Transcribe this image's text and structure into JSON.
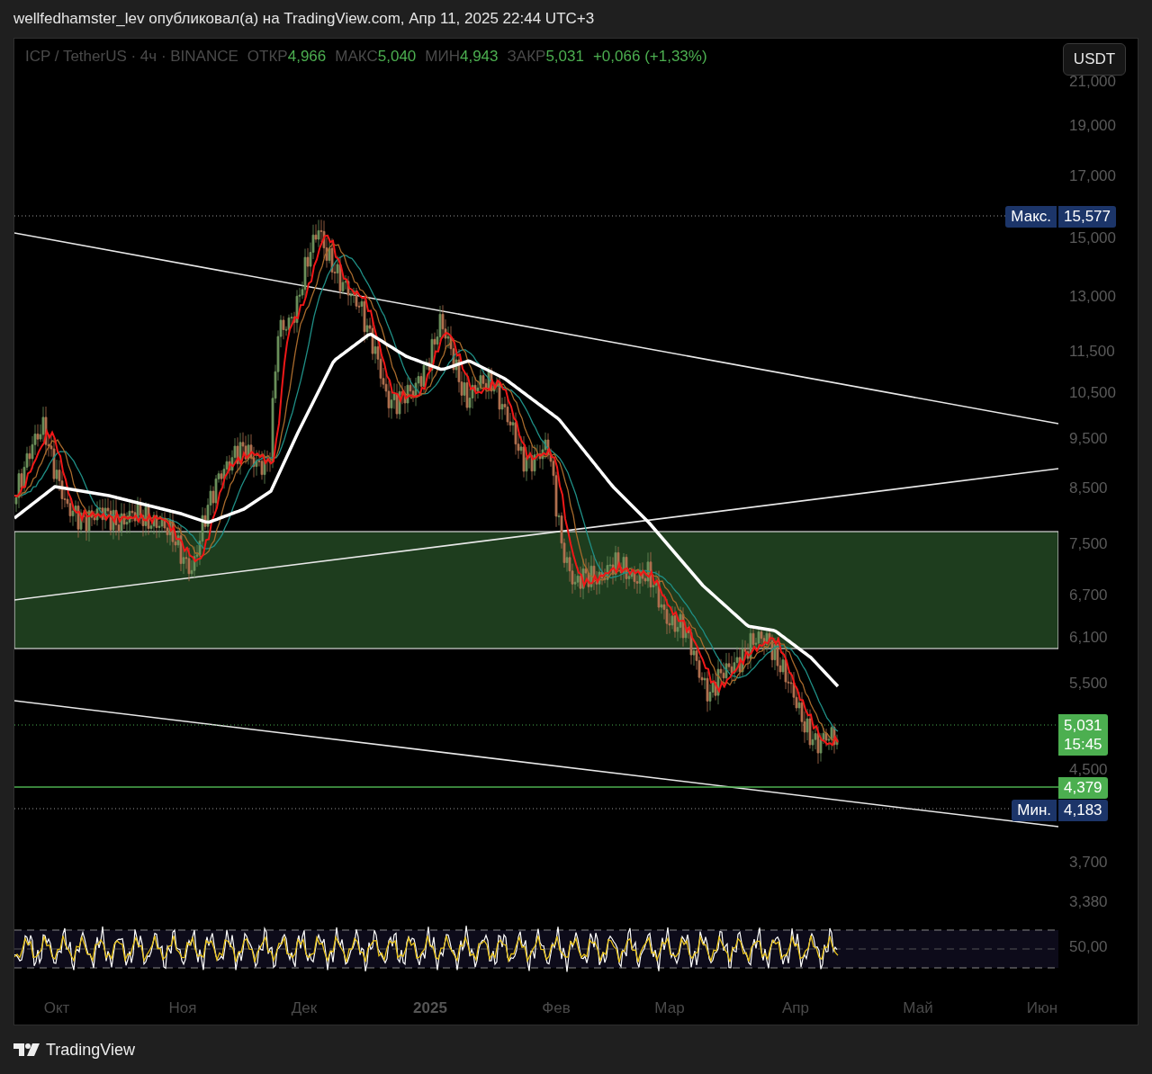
{
  "header": {
    "text": "wellfedhamster_lev опубликовал(а) на TradingView.com, Апр 11, 2025 22:44 UTC+3"
  },
  "legend": {
    "symbol": "ICP / TetherUS · 4ч · BINANCE",
    "fields": [
      {
        "label": "ОТКР",
        "value": "4,966"
      },
      {
        "label": "МАКС",
        "value": "5,040"
      },
      {
        "label": "МИН",
        "value": "4,943"
      },
      {
        "label": "ЗАКР",
        "value": "5,031"
      }
    ],
    "change": "+0,066 (+1,33%)"
  },
  "currency_button": "USDT",
  "price_axis": [
    "21,000",
    "19,000",
    "17,000",
    "15,000",
    "13,000",
    "11,500",
    "10,500",
    "9,500",
    "8,500",
    "7,500",
    "6,700",
    "6,100",
    "5,500",
    "4,500",
    "3,700",
    "3,380"
  ],
  "price_tags": [
    {
      "kind": "max",
      "label": "Макс.",
      "value": "15,577"
    },
    {
      "kind": "last",
      "value": "5,031",
      "countdown": "15:45"
    },
    {
      "kind": "level",
      "value": "4,379"
    },
    {
      "kind": "min",
      "label": "Мин.",
      "value": "4,183"
    }
  ],
  "rsi_axis": "50,00",
  "time_axis": [
    {
      "label": "Окт",
      "year": false
    },
    {
      "label": "Ноя",
      "year": false
    },
    {
      "label": "Дек",
      "year": false
    },
    {
      "label": "2025",
      "year": true
    },
    {
      "label": "Фев",
      "year": false
    },
    {
      "label": "Мар",
      "year": false
    },
    {
      "label": "Апр",
      "year": false
    },
    {
      "label": "Май",
      "year": false
    },
    {
      "label": "Июн",
      "year": false
    }
  ],
  "footer": {
    "brand": "TradingView"
  }
}
